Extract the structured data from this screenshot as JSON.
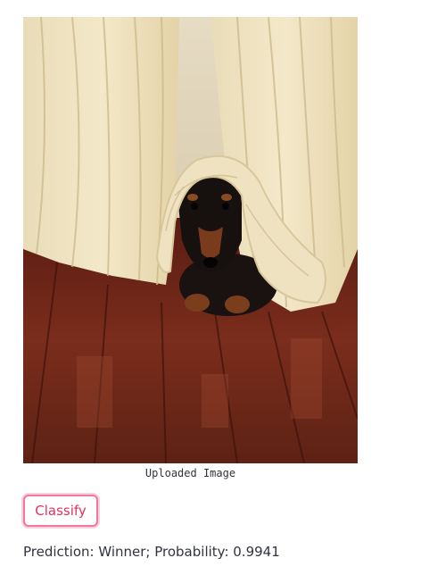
{
  "image": {
    "caption": "Uploaded Image",
    "description_icon": "dachshund-photo"
  },
  "actions": {
    "classify_label": "Classify"
  },
  "result": {
    "prediction_text": "Prediction: Winner; Probability: 0.9941"
  },
  "colors": {
    "accent": "#f0789a",
    "button_text": "#e0335f",
    "text": "#31333f"
  }
}
